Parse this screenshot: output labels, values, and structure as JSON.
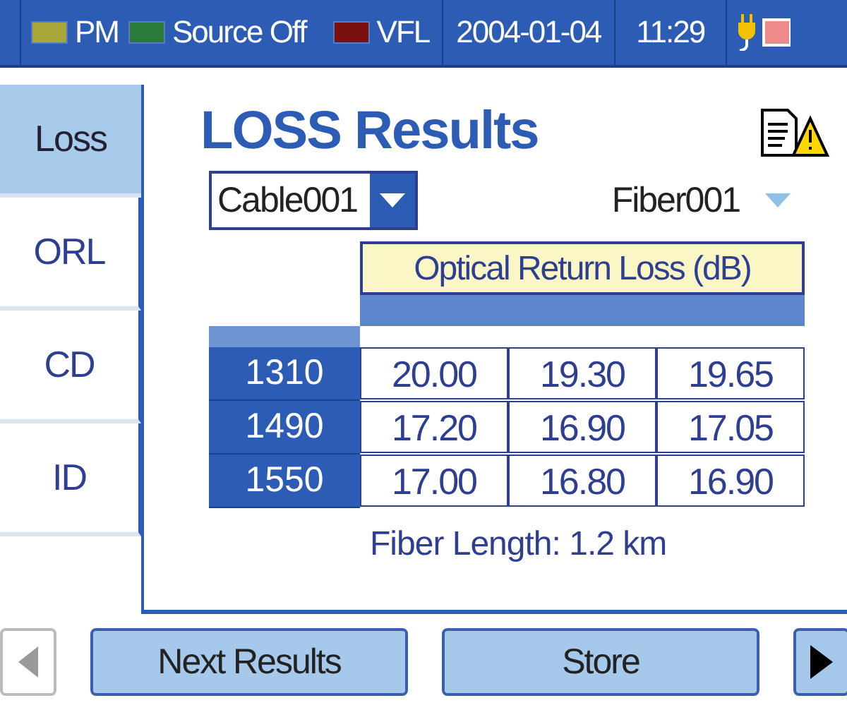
{
  "status_bar": {
    "indicators": [
      {
        "label": "PM",
        "color": "#a8a83a"
      },
      {
        "label": "Source Off",
        "color": "#2a7a3a"
      },
      {
        "label": "VFL",
        "color": "#7a1010"
      }
    ],
    "date": "2004-01-04",
    "time": "11:29"
  },
  "tabs": [
    {
      "label": "Loss",
      "selected": true
    },
    {
      "label": "ORL",
      "selected": false
    },
    {
      "label": "CD",
      "selected": false
    },
    {
      "label": "ID",
      "selected": false
    }
  ],
  "title": "LOSS Results",
  "cable_select": {
    "value": "Cable001"
  },
  "fiber_select": {
    "value": "Fiber001"
  },
  "table": {
    "header": "Optical Return Loss (dB)",
    "rows": [
      {
        "wavelength": "1310",
        "values": [
          "20.00",
          "19.30",
          "19.65"
        ]
      },
      {
        "wavelength": "1490",
        "values": [
          "17.20",
          "16.90",
          "17.05"
        ]
      },
      {
        "wavelength": "1550",
        "values": [
          "17.00",
          "16.80",
          "16.90"
        ]
      }
    ]
  },
  "fiber_length": "Fiber Length:  1.2 km",
  "buttons": [
    {
      "kind": "prev"
    },
    {
      "kind": "text",
      "label": "Next Results"
    },
    {
      "kind": "text",
      "label": "Store"
    },
    {
      "kind": "next"
    }
  ]
}
